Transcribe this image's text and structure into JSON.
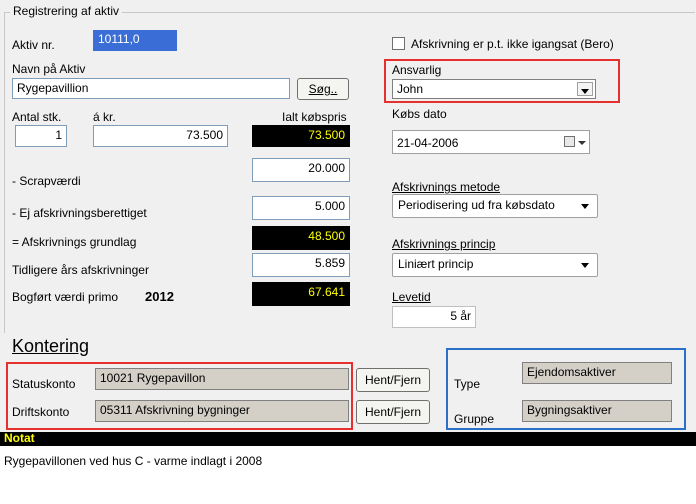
{
  "group_title": "Registrering af aktiv",
  "asset": {
    "number_label": "Aktiv nr.",
    "number_value": "10111,0",
    "name_label": "Navn på Aktiv",
    "name_value": "Rygepavillion",
    "search_button": "Søg..",
    "qty_label": "Antal stk.",
    "qty_value": "1",
    "unit_price_label": "á kr.",
    "unit_price_value": "73.500",
    "total_label": "Ialt købspris",
    "total_value": "73.500"
  },
  "values": {
    "scrap_label": "- Scrapværdi",
    "scrap_value": "20.000",
    "nondep_label": "- Ej afskrivningsberettiget",
    "nondep_value": "5.000",
    "base_label": "= Afskrivnings grundlag",
    "base_value": "48.500",
    "prior_label": "Tidligere års afskrivninger",
    "prior_value": "5.859",
    "book_label": "Bogført værdi primo",
    "book_year": "2012",
    "book_value": "67.641"
  },
  "right": {
    "bero_label": "Afskrivning er p.t. ikke igangsat (Bero)",
    "bero_checked": false,
    "responsible_label": "Ansvarlig",
    "responsible_value": "John",
    "purchase_date_label": "Købs dato",
    "purchase_date_value": "21-04-2006",
    "method_label": "Afskrivnings metode",
    "method_value": "Periodisering ud fra købsdato",
    "principle_label": "Afskrivnings princip",
    "principle_value": "Liniært princip",
    "lifetime_label": "Levetid",
    "lifetime_value": "5 år"
  },
  "kontering": {
    "title": "Kontering",
    "status_label": "Statuskonto",
    "status_value": "10021 Rygepavillon",
    "operating_label": "Driftskonto",
    "operating_value": "05311 Afskrivning bygninger",
    "fetch_button": "Hent/Fjern",
    "type_label": "Type",
    "type_value": "Ejendomsaktiver",
    "group_label": "Gruppe",
    "group_value": "Bygningsaktiver"
  },
  "note": {
    "header": "Notat",
    "text": "Rygepavillonen ved hus C - varme indlagt i 2008"
  },
  "colors": {
    "highlight_red": "#e53030",
    "highlight_blue": "#2a6fc8",
    "dark_field_text": "#ffff00"
  }
}
